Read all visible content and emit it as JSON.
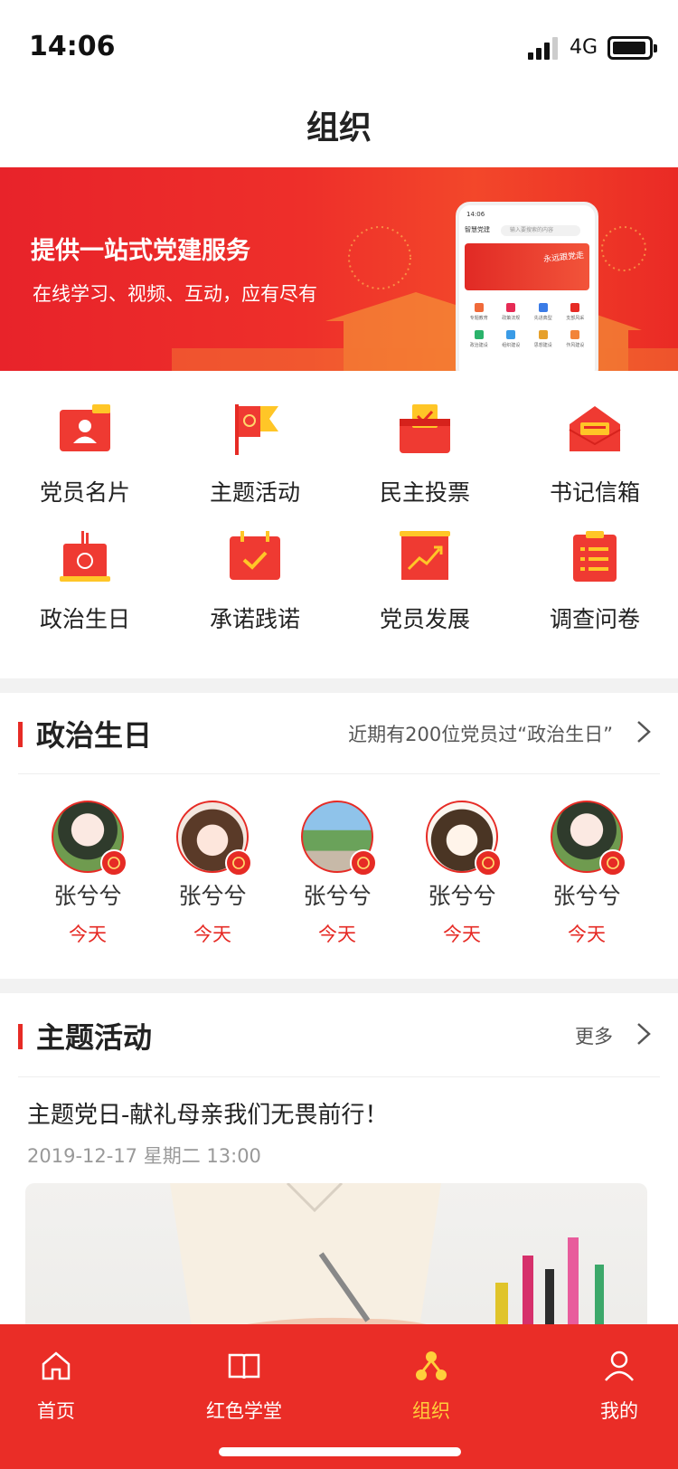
{
  "status": {
    "time": "14:06",
    "network": "4G"
  },
  "header": {
    "title": "组织"
  },
  "banner": {
    "headline": "提供一站式党建服务",
    "subline": "在线学习、视频、互动，应有尽有",
    "phone": {
      "time": "14:06",
      "app": "智慧党建",
      "search_placeholder": "输入要搜索的内容",
      "slogan": "永远跟党走",
      "items": [
        "专题教育",
        "政策法规",
        "先进典型",
        "支部风采",
        "政治建设",
        "组织建设",
        "思想建设",
        "作风建设"
      ]
    }
  },
  "features": [
    {
      "label": "党员名片",
      "icon": "member-card-icon"
    },
    {
      "label": "主题活动",
      "icon": "party-flag-icon"
    },
    {
      "label": "民主投票",
      "icon": "ballot-box-icon"
    },
    {
      "label": "书记信箱",
      "icon": "mailbox-icon"
    },
    {
      "label": "政治生日",
      "icon": "birthday-cake-icon"
    },
    {
      "label": "承诺践诺",
      "icon": "calendar-check-icon"
    },
    {
      "label": "党员发展",
      "icon": "growth-chart-icon"
    },
    {
      "label": "调查问卷",
      "icon": "clipboard-list-icon"
    }
  ],
  "birthday": {
    "title": "政治生日",
    "summary": "近期有200位党员过“政治生日”",
    "people": [
      {
        "name": "张兮兮",
        "day": "今天"
      },
      {
        "name": "张兮兮",
        "day": "今天"
      },
      {
        "name": "张兮兮",
        "day": "今天"
      },
      {
        "name": "张兮兮",
        "day": "今天"
      },
      {
        "name": "张兮兮",
        "day": "今天"
      }
    ]
  },
  "activity": {
    "title": "主题活动",
    "more": "更多",
    "item_title": "主题党日-献礼母亲我们无畏前行！",
    "item_date": "2019-12-17 星期二 13:00"
  },
  "tabs": [
    {
      "label": "首页",
      "icon": "home-icon"
    },
    {
      "label": "红色学堂",
      "icon": "book-icon"
    },
    {
      "label": "组织",
      "icon": "organization-icon"
    },
    {
      "label": "我的",
      "icon": "user-icon"
    }
  ],
  "active_tab": "组织",
  "colors": {
    "primary": "#e62b25",
    "accent": "#ffcf3b",
    "banner": "#ee2f2a"
  }
}
